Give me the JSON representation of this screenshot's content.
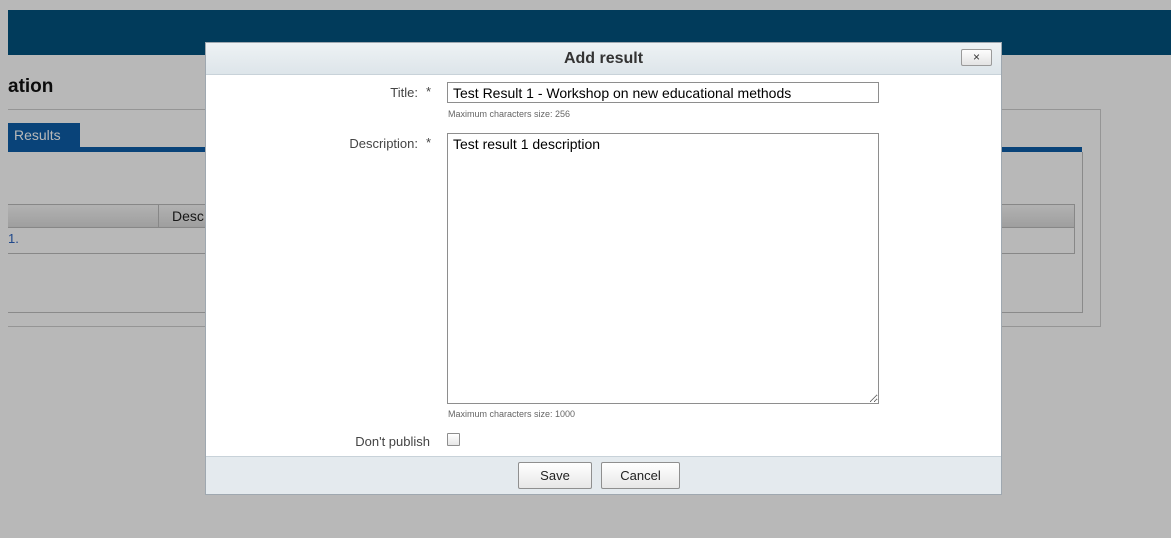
{
  "background": {
    "page_title": "ation",
    "tab_label": "Results",
    "grid_header_label": "Desc",
    "grid_row_link": "1."
  },
  "modal": {
    "title": "Add result",
    "close_label": "×",
    "fields": {
      "title_label": "Title:",
      "title_required": "*",
      "title_value": "Test Result 1 - Workshop on new educational methods",
      "title_hint": "Maximum characters size: 256",
      "description_label": "Description:",
      "description_required": "*",
      "description_value": "Test result 1 description",
      "description_hint": "Maximum characters size: 1000",
      "publish_label": "Don't publish",
      "dont_publish_checked": false
    },
    "buttons": {
      "save": "Save",
      "cancel": "Cancel"
    }
  },
  "colors": {
    "header_bar": "#02527f",
    "tab_active": "#0d5ea8"
  }
}
